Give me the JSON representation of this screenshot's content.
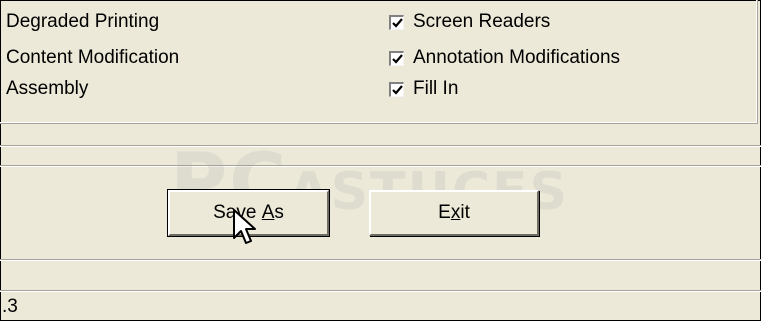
{
  "permissions": {
    "left": [
      {
        "label": "Degraded Printing"
      },
      {
        "label": "Content Modification"
      },
      {
        "label": "Assembly"
      }
    ],
    "right": [
      {
        "label": "Screen Readers",
        "checked": true
      },
      {
        "label": "Annotation Modifications",
        "checked": true
      },
      {
        "label": "Fill In",
        "checked": true
      }
    ]
  },
  "buttons": {
    "save_as": {
      "pre": "Sa",
      "mid": "v",
      "post": "e ",
      "accel": "A",
      "rest": "s"
    },
    "exit": {
      "pre": "E",
      "accel": "x",
      "rest": "it"
    }
  },
  "watermark": {
    "big": "PC",
    "small": "ASTUCES"
  },
  "status": {
    "text": ".3"
  }
}
